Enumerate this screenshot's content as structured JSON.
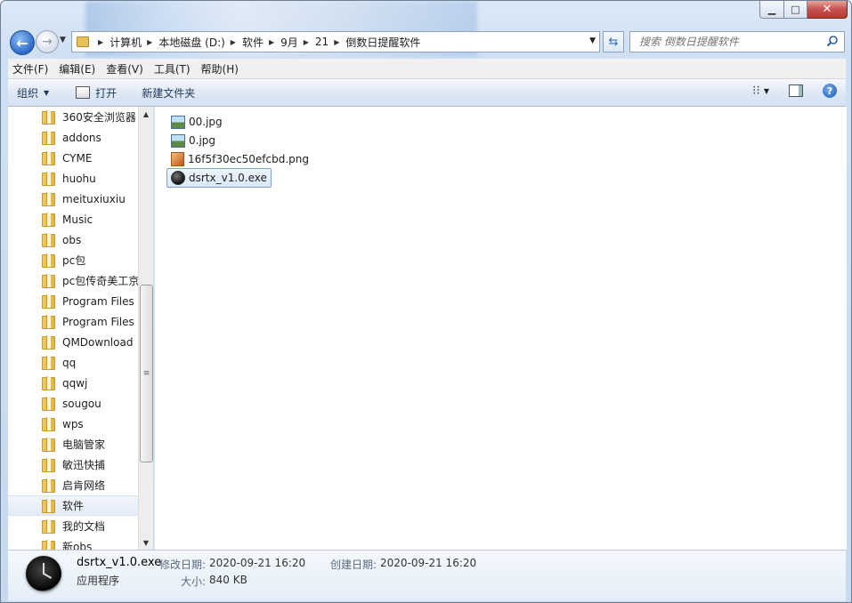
{
  "window": {
    "caption": {
      "minimize": "▁",
      "maximize": "□",
      "close": "✕"
    }
  },
  "nav": {
    "breadcrumbs": [
      "计算机",
      "本地磁盘 (D:)",
      "软件",
      "9月",
      "21",
      "倒数日提醒软件"
    ],
    "search_placeholder": "搜索 倒数日提醒软件"
  },
  "menu": {
    "items": [
      "文件(F)",
      "编辑(E)",
      "查看(V)",
      "工具(T)",
      "帮助(H)"
    ]
  },
  "toolbar": {
    "organize": "组织",
    "open": "打开",
    "new_folder": "新建文件夹"
  },
  "sidebar": {
    "items": [
      "360安全浏览器",
      "addons",
      "CYME",
      "huohu",
      "meituxiuxiu",
      "Music",
      "obs",
      "pc包",
      "pc包传奇美工京",
      "Program Files",
      "Program Files",
      "QMDownload",
      "qq",
      "qqwj",
      "sougou",
      "wps",
      "电脑管家",
      "敏迅快捕",
      "启肯网络",
      "软件",
      "我的文档",
      "新obs"
    ],
    "selected": "软件"
  },
  "files": [
    {
      "name": "00.jpg",
      "icon": "jpg-image-icon"
    },
    {
      "name": "0.jpg",
      "icon": "jpg-image-icon"
    },
    {
      "name": "16f5f30ec50efcbd.png",
      "icon": "png-image-icon"
    },
    {
      "name": "dsrtx_v1.0.exe",
      "icon": "clock-app-icon",
      "selected": true
    }
  ],
  "details": {
    "name": "dsrtx_v1.0.exe",
    "type": "应用程序",
    "modified_label": "修改日期:",
    "modified_value": "2020-09-21 16:20",
    "created_label": "创建日期:",
    "created_value": "2020-09-21 16:20",
    "size_label": "大小:",
    "size_value": "840 KB"
  },
  "colors": {
    "chrome": "#cfe0f3",
    "selection": "#d9e8fb",
    "selection_border": "#7da2ce",
    "close_button": "#c75050"
  }
}
